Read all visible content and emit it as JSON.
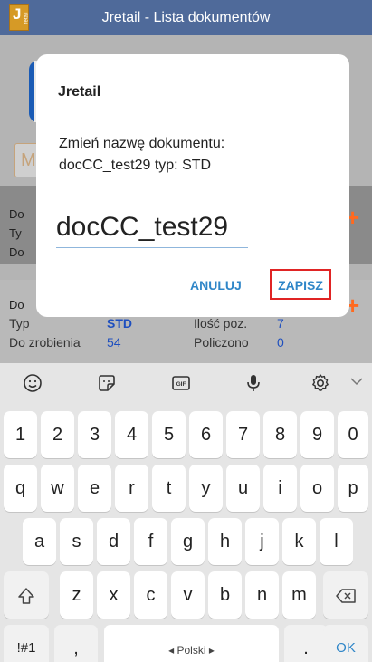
{
  "appbar": {
    "title": "Jretail - Lista dokumentów",
    "logo_text": "J",
    "logo_subtext": "retail"
  },
  "background": {
    "search_letter": "M",
    "row1_labels": [
      "Do",
      "Ty",
      "Do"
    ],
    "row2_label": "Do",
    "doc": {
      "type_label": "Typ",
      "type_value": "STD",
      "count_label": "Ilość poz.",
      "count_value": "7",
      "todo_label": "Do zrobienia",
      "todo_value": "54",
      "counted_label": "Policzono",
      "counted_value": "0"
    }
  },
  "dialog": {
    "title": "Jretail",
    "message_line1": "Zmień nazwę dokumentu:",
    "message_line2": "docCC_test29 typ: STD",
    "input_value": "docCC_test29",
    "cancel_label": "ANULUJ",
    "save_label": "ZAPISZ"
  },
  "keyboard": {
    "tool_icons": [
      "smiley-icon",
      "sticker-icon",
      "gif-icon",
      "microphone-icon",
      "settings-icon",
      "chevron-down-icon"
    ],
    "gif_label": "GIF",
    "row_numbers": [
      "1",
      "2",
      "3",
      "4",
      "5",
      "6",
      "7",
      "8",
      "9",
      "0"
    ],
    "row_q": [
      "q",
      "w",
      "e",
      "r",
      "t",
      "y",
      "u",
      "i",
      "o",
      "p"
    ],
    "row_a": [
      "a",
      "s",
      "d",
      "f",
      "g",
      "h",
      "j",
      "k",
      "l"
    ],
    "row_z": [
      "z",
      "x",
      "c",
      "v",
      "b",
      "n",
      "m"
    ],
    "symbols_label": "!#1",
    "comma_label": ",",
    "space_label": "Polski",
    "period_label": ".",
    "ok_label": "OK"
  },
  "colors": {
    "appbar": "#4f6a9a",
    "accent": "#2f86c8",
    "highlight": "#e02424",
    "plus": "#ff6a1f"
  }
}
